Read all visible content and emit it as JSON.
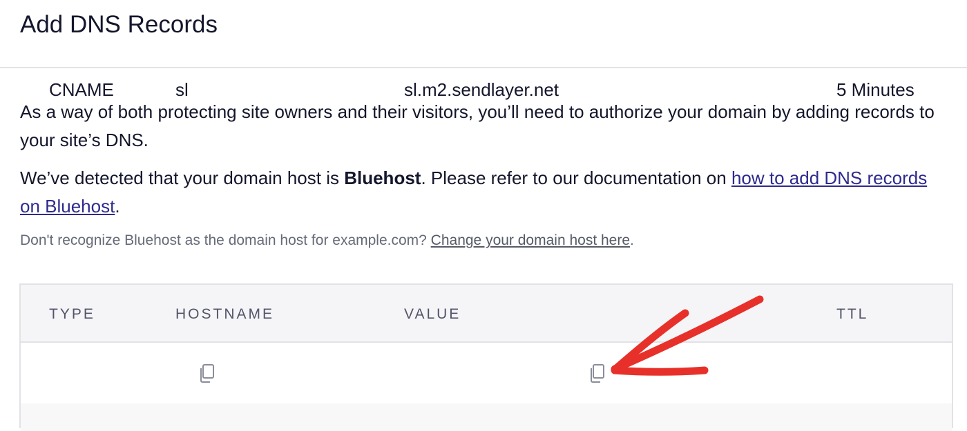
{
  "page": {
    "title": "Add DNS Records",
    "intro": "As a way of both protecting site owners and their visitors, you’ll need to authorize your domain by adding records to your site’s DNS.",
    "detected_prefix": "We’ve detected that your domain host is ",
    "host_name": "Bluehost",
    "detected_middle": ". Please refer to our documentation on ",
    "doc_link": "how to add DNS records on Bluehost",
    "detected_suffix": ".",
    "note_prefix": "Don't recognize Bluehost as the domain host for example.com? ",
    "note_link": "Change your domain host here",
    "note_suffix": "."
  },
  "table": {
    "headers": {
      "type": "TYPE",
      "hostname": "HOSTNAME",
      "value": "VALUE",
      "ttl": "TTL"
    },
    "rows": [
      {
        "type": "CNAME",
        "hostname": "sl",
        "value": "sl.m2.sendlayer.net",
        "ttl": "5 Minutes"
      }
    ]
  },
  "icons": {
    "copy": "copy-icon",
    "annotation": "red-arrow-annotation"
  },
  "colors": {
    "link": "#2e2a8e",
    "arrow": "#e8302a",
    "header_bg": "#f5f5f7",
    "border": "#e1e2e6"
  }
}
